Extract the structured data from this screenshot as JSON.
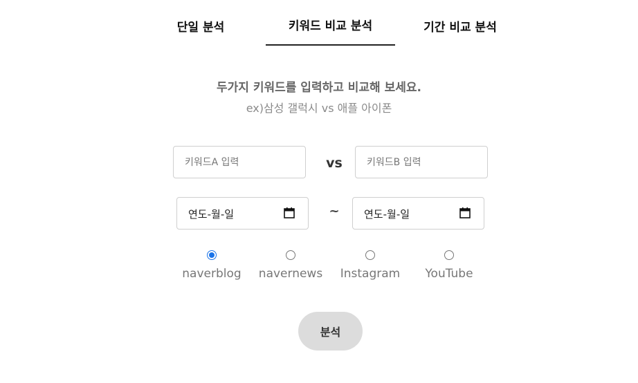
{
  "tabs": [
    {
      "label": "단일 분석"
    },
    {
      "label": "키워드 비교 분석"
    },
    {
      "label": "기간 비교 분석"
    }
  ],
  "description": {
    "line1": "두가지 키워드를 입력하고 비교해 보세요.",
    "line2": "ex)삼성 갤럭시 vs 애플 아이폰"
  },
  "keyword_a": {
    "value": "",
    "placeholder": "키워드A 입력"
  },
  "keyword_b": {
    "value": "",
    "placeholder": "키워드B 입력"
  },
  "vs_label": "vs",
  "date_start": {
    "placeholder": "연도-월-일"
  },
  "date_end": {
    "placeholder": "연도-월-일"
  },
  "range_separator": "~",
  "sources": [
    {
      "label": "naverblog",
      "checked": true
    },
    {
      "label": "navernews",
      "checked": false
    },
    {
      "label": "Instagram",
      "checked": false
    },
    {
      "label": "YouTube",
      "checked": false
    }
  ],
  "submit_label": "분석",
  "colors": {
    "accent": "#1a73e8",
    "button_bg": "#dcdcdc",
    "border": "#cfcfcf"
  }
}
